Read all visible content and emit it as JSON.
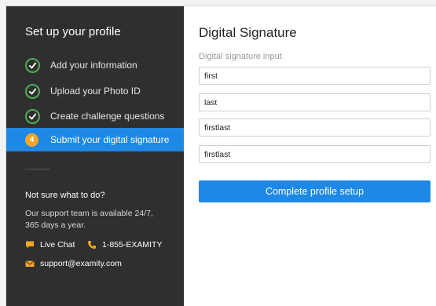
{
  "sidebar": {
    "title": "Set up your profile",
    "steps": [
      {
        "label": "Add your information",
        "status": "complete"
      },
      {
        "label": "Upload your Photo ID",
        "status": "complete"
      },
      {
        "label": "Create challenge questions",
        "status": "complete"
      },
      {
        "label": "Submit your digital signature",
        "status": "active",
        "number": "4"
      }
    ],
    "help": {
      "title": "Not sure what to do?",
      "text": "Our support team is available 24/7, 365 days a year.",
      "live_chat": "Live Chat",
      "phone": "1-855-EXAMITY",
      "email": "support@examity.com"
    }
  },
  "main": {
    "title": "Digital Signature",
    "input_label": "Digital signature input",
    "fields": [
      "first",
      "last",
      "firstlast",
      "firstlast"
    ],
    "submit_label": "Complete profile setup"
  },
  "colors": {
    "accent": "#1e88e5",
    "complete": "#4caf50",
    "step_number": "#f5a623",
    "sidebar_bg": "#2f2f2f"
  }
}
